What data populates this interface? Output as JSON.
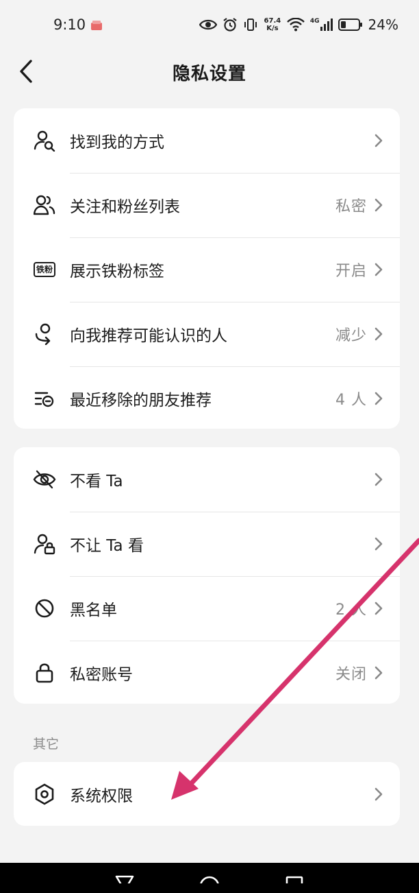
{
  "status_bar": {
    "time": "9:10",
    "net_speed_value": "67.4",
    "net_speed_unit": "K/s",
    "network_type": "4G",
    "battery": "24%"
  },
  "header": {
    "title": "隐私设置"
  },
  "group1": [
    {
      "label": "找到我的方式",
      "value": "",
      "icon": "person-search-icon"
    },
    {
      "label": "关注和粉丝列表",
      "value": "私密",
      "icon": "people-icon"
    },
    {
      "label": "展示铁粉标签",
      "value": "开启",
      "icon": "fan-badge-icon",
      "badge_text": "铁粉"
    },
    {
      "label": "向我推荐可能认识的人",
      "value": "减少",
      "icon": "recommend-person-icon"
    },
    {
      "label": "最近移除的朋友推荐",
      "value": "4 人",
      "icon": "removed-list-icon"
    }
  ],
  "group2": [
    {
      "label": "不看 Ta",
      "value": "",
      "icon": "eye-off-icon"
    },
    {
      "label": "不让 Ta 看",
      "value": "",
      "icon": "person-lock-icon"
    },
    {
      "label": "黑名单",
      "value": "2 人",
      "icon": "block-icon"
    },
    {
      "label": "私密账号",
      "value": "关闭",
      "icon": "lock-icon"
    }
  ],
  "section_other": "其它",
  "group3": [
    {
      "label": "系统权限",
      "value": "",
      "icon": "hexagon-settings-icon"
    }
  ],
  "colors": {
    "background": "#f3f3f3",
    "card": "#ffffff",
    "annotation_arrow": "#d6336c"
  }
}
